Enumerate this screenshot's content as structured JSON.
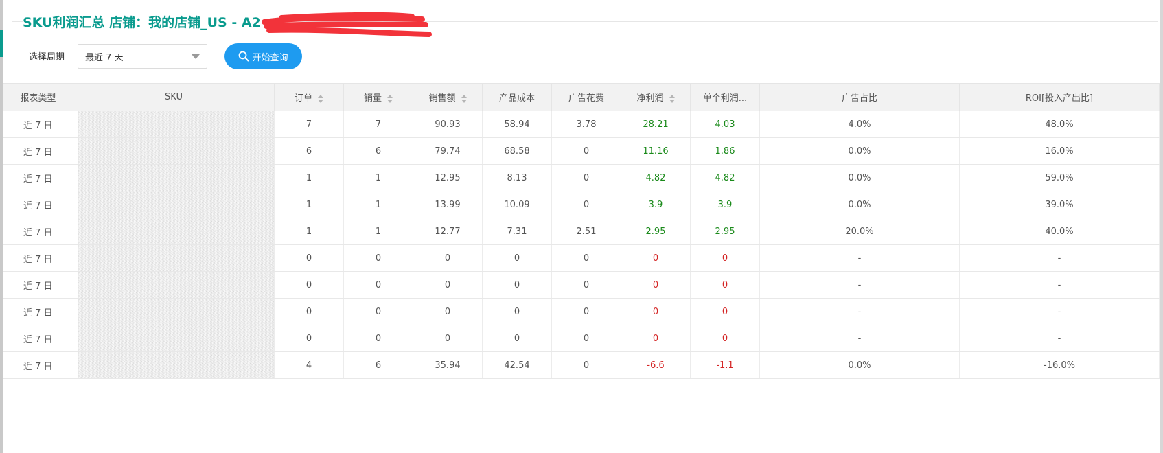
{
  "page": {
    "title": "SKU利润汇总 店铺：我的店铺_US - A2"
  },
  "filter": {
    "period_label": "选择周期",
    "period_value": "最近 7 天",
    "query_button": "开始查询"
  },
  "colors": {
    "accent": "#0a9b8e",
    "button": "#1e9bf0",
    "positive": "#1a8a1a",
    "negative": "#d42424"
  },
  "table": {
    "columns": [
      "报表类型",
      "SKU",
      "订单",
      "销量",
      "销售额",
      "产品成本",
      "广告花费",
      "净利润",
      "单个利润...",
      "广告占比",
      "ROI[投入产出比]"
    ],
    "rows": [
      {
        "type": "近 7 日",
        "orders": "7",
        "qty": "7",
        "sales": "90.93",
        "cost": "58.94",
        "ad": "3.78",
        "profit": "28.21",
        "unit": "4.03",
        "adpct": "4.0%",
        "roi": "48.0%",
        "sign": "pos"
      },
      {
        "type": "近 7 日",
        "orders": "6",
        "qty": "6",
        "sales": "79.74",
        "cost": "68.58",
        "ad": "0",
        "profit": "11.16",
        "unit": "1.86",
        "adpct": "0.0%",
        "roi": "16.0%",
        "sign": "pos"
      },
      {
        "type": "近 7 日",
        "orders": "1",
        "qty": "1",
        "sales": "12.95",
        "cost": "8.13",
        "ad": "0",
        "profit": "4.82",
        "unit": "4.82",
        "adpct": "0.0%",
        "roi": "59.0%",
        "sign": "pos"
      },
      {
        "type": "近 7 日",
        "orders": "1",
        "qty": "1",
        "sales": "13.99",
        "cost": "10.09",
        "ad": "0",
        "profit": "3.9",
        "unit": "3.9",
        "adpct": "0.0%",
        "roi": "39.0%",
        "sign": "pos"
      },
      {
        "type": "近 7 日",
        "orders": "1",
        "qty": "1",
        "sales": "12.77",
        "cost": "7.31",
        "ad": "2.51",
        "profit": "2.95",
        "unit": "2.95",
        "adpct": "20.0%",
        "roi": "40.0%",
        "sign": "pos"
      },
      {
        "type": "近 7 日",
        "orders": "0",
        "qty": "0",
        "sales": "0",
        "cost": "0",
        "ad": "0",
        "profit": "0",
        "unit": "0",
        "adpct": "-",
        "roi": "-",
        "sign": "neg"
      },
      {
        "type": "近 7 日",
        "orders": "0",
        "qty": "0",
        "sales": "0",
        "cost": "0",
        "ad": "0",
        "profit": "0",
        "unit": "0",
        "adpct": "-",
        "roi": "-",
        "sign": "neg"
      },
      {
        "type": "近 7 日",
        "orders": "0",
        "qty": "0",
        "sales": "0",
        "cost": "0",
        "ad": "0",
        "profit": "0",
        "unit": "0",
        "adpct": "-",
        "roi": "-",
        "sign": "neg"
      },
      {
        "type": "近 7 日",
        "orders": "0",
        "qty": "0",
        "sales": "0",
        "cost": "0",
        "ad": "0",
        "profit": "0",
        "unit": "0",
        "adpct": "-",
        "roi": "-",
        "sign": "neg"
      },
      {
        "type": "近 7 日",
        "orders": "4",
        "qty": "6",
        "sales": "35.94",
        "cost": "42.54",
        "ad": "0",
        "profit": "-6.6",
        "unit": "-1.1",
        "adpct": "0.0%",
        "roi": "-16.0%",
        "sign": "neg"
      }
    ]
  }
}
